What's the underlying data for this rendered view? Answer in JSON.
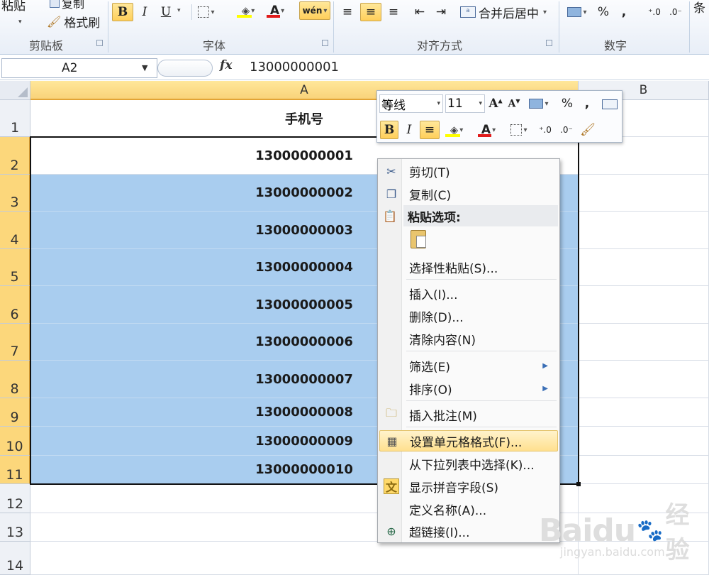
{
  "ribbon": {
    "clipboard": {
      "paste_label": "粘贴",
      "copy_label": "复制",
      "format_painter_label": "格式刷",
      "group_label": "剪贴板"
    },
    "font": {
      "bold": "B",
      "italic": "I",
      "underline": "U",
      "font_color_letter": "A",
      "group_label": "字体"
    },
    "alignment": {
      "merge_center_label": "合并后居中",
      "group_label": "对齐方式"
    },
    "number": {
      "percent": "%",
      "comma": ",",
      "group_label": "数字"
    },
    "cut_off_text": "条"
  },
  "formula_bar": {
    "name_box": "A2",
    "fx": "fx",
    "value": "13000000001"
  },
  "grid": {
    "columns": [
      {
        "label": "A",
        "selected": true
      },
      {
        "label": "B",
        "selected": false
      }
    ],
    "header_cell": "手机号",
    "rows": [
      {
        "num": "1",
        "value": "手机号"
      },
      {
        "num": "2",
        "value": "13000000001"
      },
      {
        "num": "3",
        "value": "13000000002"
      },
      {
        "num": "4",
        "value": "13000000003"
      },
      {
        "num": "5",
        "value": "13000000004"
      },
      {
        "num": "6",
        "value": "13000000005"
      },
      {
        "num": "7",
        "value": "13000000006"
      },
      {
        "num": "8",
        "value": "13000000007"
      },
      {
        "num": "9",
        "value": "13000000008"
      },
      {
        "num": "10",
        "value": "13000000009"
      },
      {
        "num": "11",
        "value": "13000000010"
      },
      {
        "num": "12",
        "value": ""
      },
      {
        "num": "13",
        "value": ""
      },
      {
        "num": "14",
        "value": ""
      }
    ]
  },
  "mini_toolbar": {
    "font_name": "等线",
    "font_size": "11",
    "percent": "%",
    "comma": ",",
    "bold": "B",
    "italic": "I",
    "font_color_letter": "A"
  },
  "context_menu": {
    "items": [
      {
        "label": "剪切(T)",
        "icon": "scissors-icon"
      },
      {
        "label": "复制(C)",
        "icon": "copy-icon"
      },
      {
        "label": "粘贴选项:",
        "icon": "paste-icon"
      },
      {
        "label": "选择性粘贴(S)...",
        "icon": ""
      },
      {
        "label": "插入(I)...",
        "icon": ""
      },
      {
        "label": "删除(D)...",
        "icon": ""
      },
      {
        "label": "清除内容(N)",
        "icon": ""
      },
      {
        "label": "筛选(E)",
        "icon": ""
      },
      {
        "label": "排序(O)",
        "icon": ""
      },
      {
        "label": "插入批注(M)",
        "icon": "comment-icon"
      },
      {
        "label": "设置单元格格式(F)...",
        "icon": "format-cells-icon"
      },
      {
        "label": "从下拉列表中选择(K)...",
        "icon": ""
      },
      {
        "label": "显示拼音字段(S)",
        "icon": "pinyin-icon"
      },
      {
        "label": "定义名称(A)...",
        "icon": ""
      },
      {
        "label": "超链接(I)...",
        "icon": "hyperlink-icon"
      }
    ]
  },
  "watermark": {
    "brand": "Baidu",
    "cn": "经验",
    "url": "jingyan.baidu.com"
  },
  "colors": {
    "selection_fill": "#a9cdef",
    "header_highlight": "#fcd77b",
    "button_active": "#ffcf5a",
    "font_red": "#e01b1b",
    "highlight_yellow": "#ffff00"
  }
}
